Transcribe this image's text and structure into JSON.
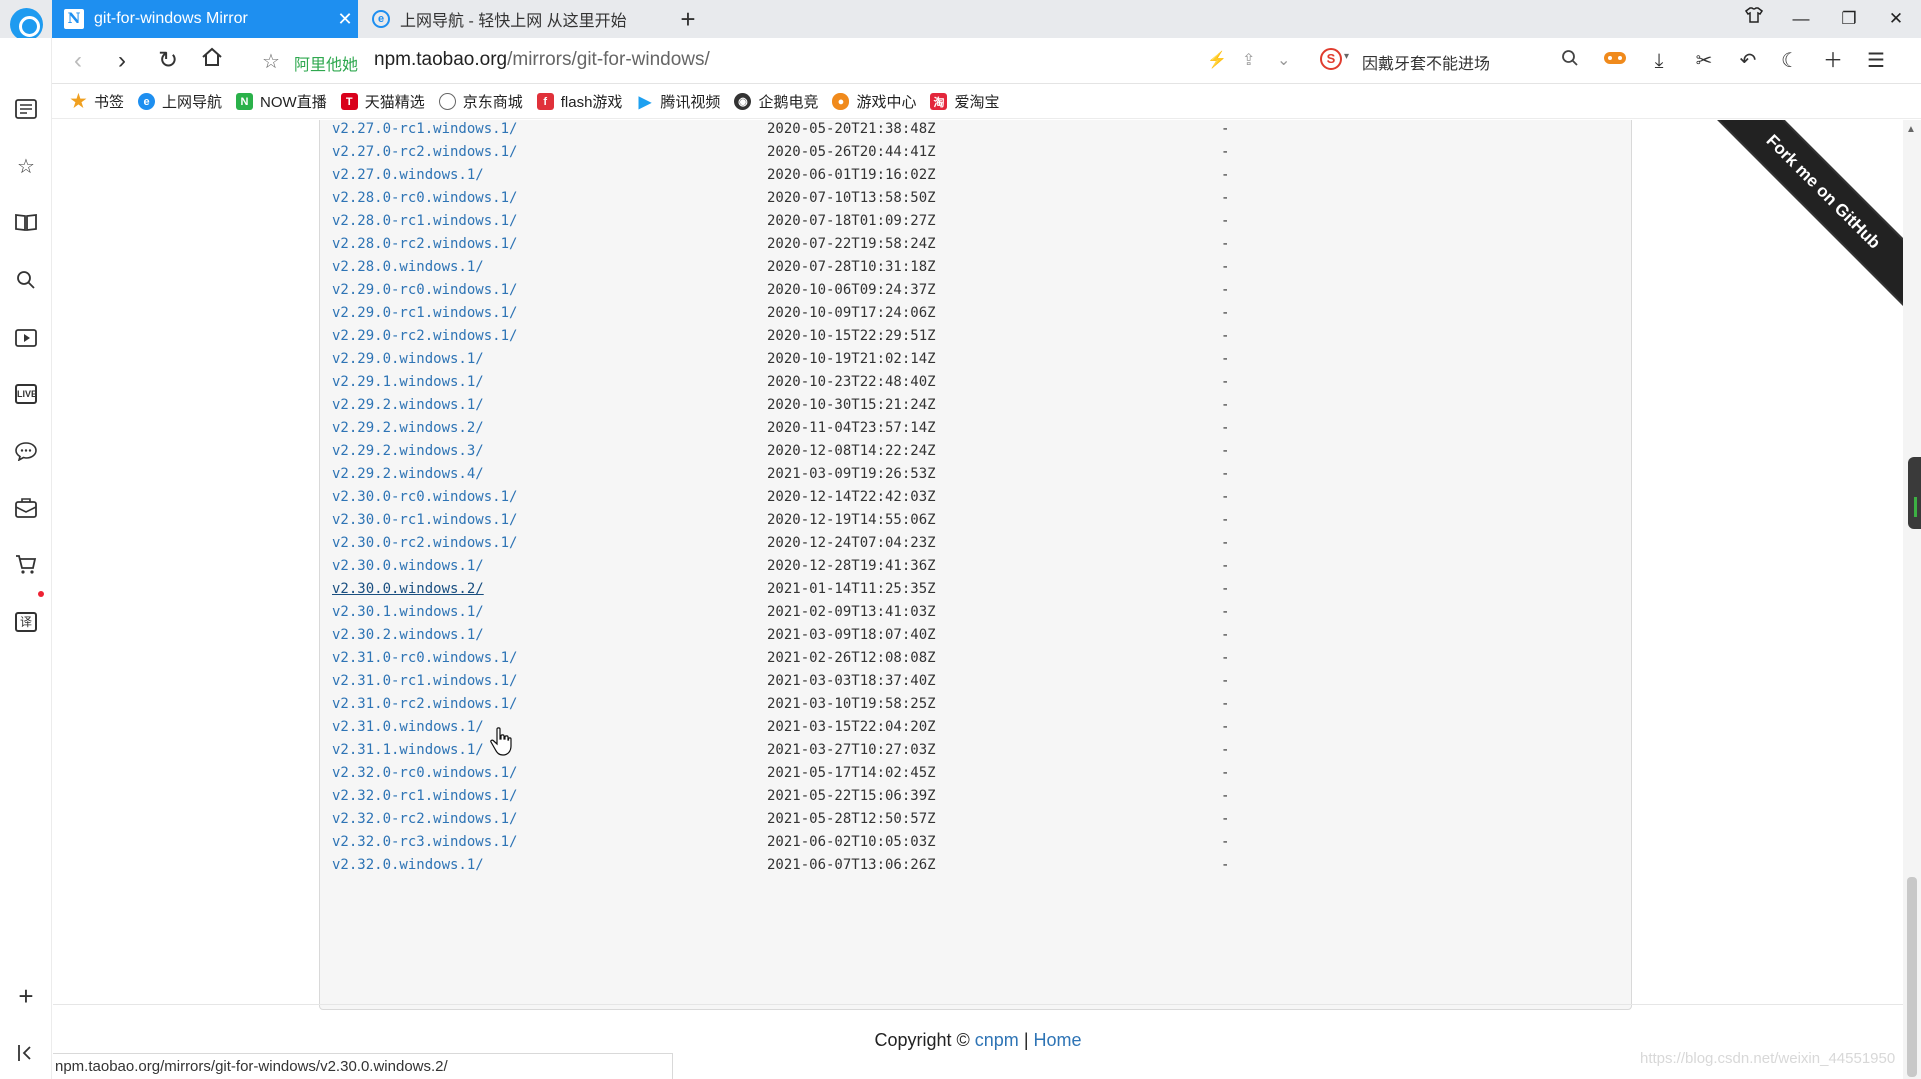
{
  "tabs": [
    {
      "title": "git-for-windows Mirror",
      "favicon": "N"
    },
    {
      "title": "上网导航 - 轻快上网 从这里开始",
      "favicon": "e"
    }
  ],
  "new_tab_icon": "+",
  "address_bar": {
    "verified_label": "阿里他她",
    "url_host": "npm.taobao.org",
    "url_path": "/mirrors/git-for-windows/",
    "search_engine_badge": "S",
    "search_text": "因戴牙套不能进场"
  },
  "bookmarks": [
    {
      "label": "书签",
      "icon": "star-icon"
    },
    {
      "label": "上网导航",
      "icon": "ie-icon"
    },
    {
      "label": "NOW直播",
      "icon": "now-icon"
    },
    {
      "label": "天猫精选",
      "icon": "tmall-icon"
    },
    {
      "label": "京东商城",
      "icon": "globe-icon"
    },
    {
      "label": "flash游戏",
      "icon": "flash-icon"
    },
    {
      "label": "腾讯视频",
      "icon": "video-icon"
    },
    {
      "label": "企鹅电竞",
      "icon": "penguin-icon"
    },
    {
      "label": "游戏中心",
      "icon": "gamepad-icon"
    },
    {
      "label": "爱淘宝",
      "icon": "taobao-icon"
    }
  ],
  "sidebar_live_label": "LIVE",
  "sidebar_translate_label": "译",
  "listing": [
    {
      "name": "v2.27.0-rc1.windows.1/",
      "date": "2020-05-20T21:38:48Z",
      "size": "-"
    },
    {
      "name": "v2.27.0-rc2.windows.1/",
      "date": "2020-05-26T20:44:41Z",
      "size": "-"
    },
    {
      "name": "v2.27.0.windows.1/",
      "date": "2020-06-01T19:16:02Z",
      "size": "-"
    },
    {
      "name": "v2.28.0-rc0.windows.1/",
      "date": "2020-07-10T13:58:50Z",
      "size": "-"
    },
    {
      "name": "v2.28.0-rc1.windows.1/",
      "date": "2020-07-18T01:09:27Z",
      "size": "-"
    },
    {
      "name": "v2.28.0-rc2.windows.1/",
      "date": "2020-07-22T19:58:24Z",
      "size": "-"
    },
    {
      "name": "v2.28.0.windows.1/",
      "date": "2020-07-28T10:31:18Z",
      "size": "-"
    },
    {
      "name": "v2.29.0-rc0.windows.1/",
      "date": "2020-10-06T09:24:37Z",
      "size": "-"
    },
    {
      "name": "v2.29.0-rc1.windows.1/",
      "date": "2020-10-09T17:24:06Z",
      "size": "-"
    },
    {
      "name": "v2.29.0-rc2.windows.1/",
      "date": "2020-10-15T22:29:51Z",
      "size": "-"
    },
    {
      "name": "v2.29.0.windows.1/",
      "date": "2020-10-19T21:02:14Z",
      "size": "-"
    },
    {
      "name": "v2.29.1.windows.1/",
      "date": "2020-10-23T22:48:40Z",
      "size": "-"
    },
    {
      "name": "v2.29.2.windows.1/",
      "date": "2020-10-30T15:21:24Z",
      "size": "-"
    },
    {
      "name": "v2.29.2.windows.2/",
      "date": "2020-11-04T23:57:14Z",
      "size": "-"
    },
    {
      "name": "v2.29.2.windows.3/",
      "date": "2020-12-08T14:22:24Z",
      "size": "-"
    },
    {
      "name": "v2.29.2.windows.4/",
      "date": "2021-03-09T19:26:53Z",
      "size": "-"
    },
    {
      "name": "v2.30.0-rc0.windows.1/",
      "date": "2020-12-14T22:42:03Z",
      "size": "-"
    },
    {
      "name": "v2.30.0-rc1.windows.1/",
      "date": "2020-12-19T14:55:06Z",
      "size": "-"
    },
    {
      "name": "v2.30.0-rc2.windows.1/",
      "date": "2020-12-24T07:04:23Z",
      "size": "-"
    },
    {
      "name": "v2.30.0.windows.1/",
      "date": "2020-12-28T19:41:36Z",
      "size": "-"
    },
    {
      "name": "v2.30.0.windows.2/",
      "date": "2021-01-14T11:25:35Z",
      "size": "-"
    },
    {
      "name": "v2.30.1.windows.1/",
      "date": "2021-02-09T13:41:03Z",
      "size": "-"
    },
    {
      "name": "v2.30.2.windows.1/",
      "date": "2021-03-09T18:07:40Z",
      "size": "-"
    },
    {
      "name": "v2.31.0-rc0.windows.1/",
      "date": "2021-02-26T12:08:08Z",
      "size": "-"
    },
    {
      "name": "v2.31.0-rc1.windows.1/",
      "date": "2021-03-03T18:37:40Z",
      "size": "-"
    },
    {
      "name": "v2.31.0-rc2.windows.1/",
      "date": "2021-03-10T19:58:25Z",
      "size": "-"
    },
    {
      "name": "v2.31.0.windows.1/",
      "date": "2021-03-15T22:04:20Z",
      "size": "-"
    },
    {
      "name": "v2.31.1.windows.1/",
      "date": "2021-03-27T10:27:03Z",
      "size": "-"
    },
    {
      "name": "v2.32.0-rc0.windows.1/",
      "date": "2021-05-17T14:02:45Z",
      "size": "-"
    },
    {
      "name": "v2.32.0-rc1.windows.1/",
      "date": "2021-05-22T15:06:39Z",
      "size": "-"
    },
    {
      "name": "v2.32.0-rc2.windows.1/",
      "date": "2021-05-28T12:50:57Z",
      "size": "-"
    },
    {
      "name": "v2.32.0-rc3.windows.1/",
      "date": "2021-06-02T10:05:03Z",
      "size": "-"
    },
    {
      "name": "v2.32.0.windows.1/",
      "date": "2021-06-07T13:06:26Z",
      "size": "-"
    }
  ],
  "hovered_row_index": 20,
  "ribbon_text": "Fork me on GitHub",
  "footer": {
    "copyright": "Copyright ©",
    "link_cnpm": "cnpm",
    "separator": "|",
    "link_home": "Home"
  },
  "status_bar_url": "npm.taobao.org/mirrors/git-for-windows/v2.30.0.windows.2/",
  "watermark": "https://blog.csdn.net/weixin_44551950",
  "colors": {
    "accent": "#1e8ff0",
    "link": "#2e74b5",
    "verified": "#2fa84f"
  }
}
